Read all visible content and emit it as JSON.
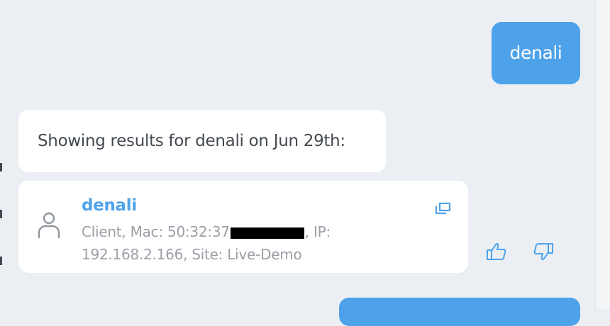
{
  "conversation": {
    "user_message": "denali",
    "assistant_message": "Showing results for denali on Jun 29th:"
  },
  "result_card": {
    "name": "denali",
    "details_before_redaction": "Client, Mac: 50:32:37",
    "details_after_redaction": ", IP:",
    "details_line_two": "192.168.2.166, Site: Live-Demo"
  },
  "icons": {
    "person": "person-icon",
    "open": "open-in-new-window-icon",
    "thumbs_up": "thumbs-up-icon",
    "thumbs_down": "thumbs-down-icon"
  },
  "colors": {
    "accent": "#4ea2ea",
    "background": "#ebeff3",
    "card": "#ffffff",
    "primary_text": "#444a50",
    "secondary_text": "#9a9fa6",
    "redaction": "#000000"
  }
}
